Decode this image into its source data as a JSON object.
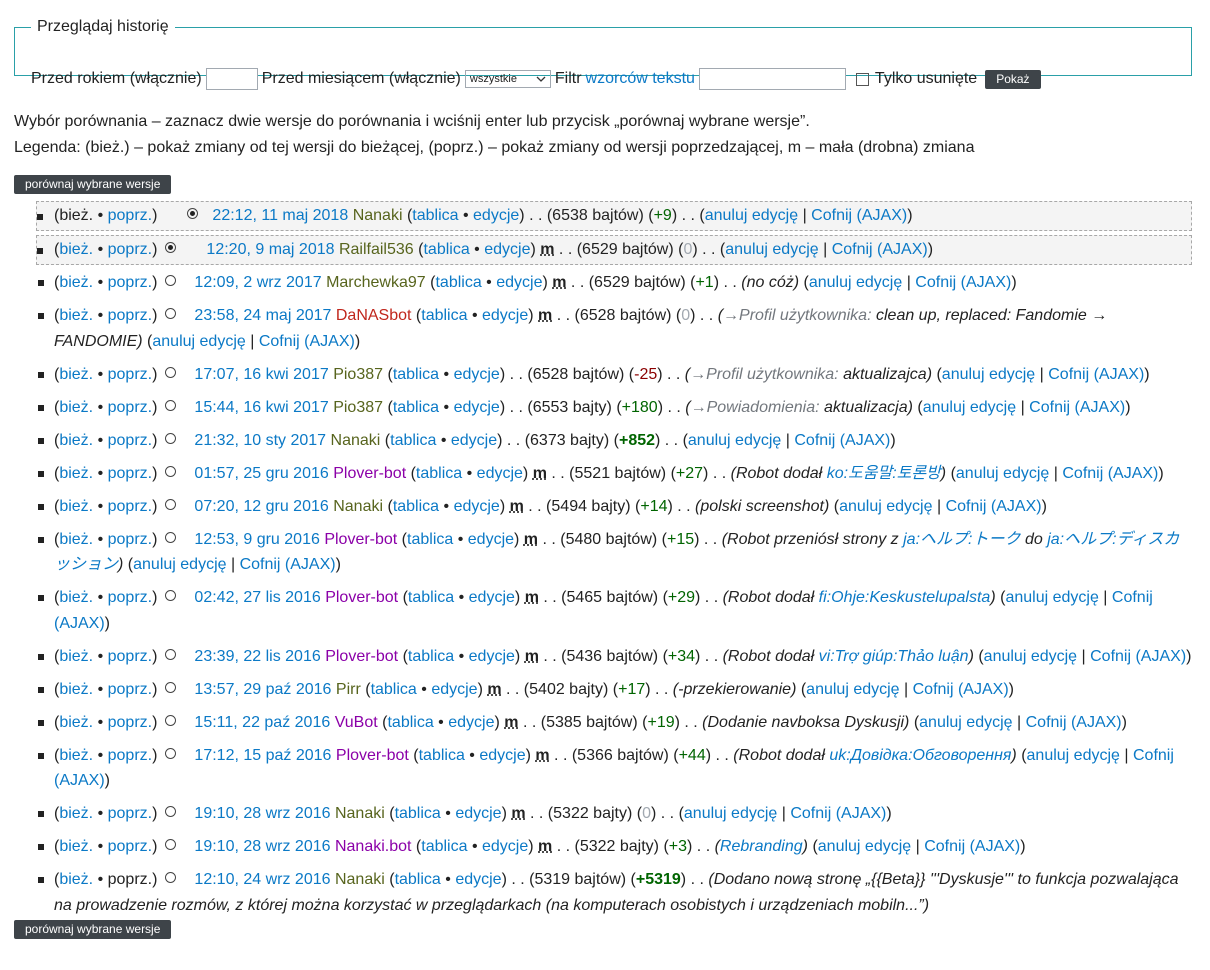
{
  "filter": {
    "legend": "Przeglądaj historię",
    "year_label": "Przed rokiem (włącznie)",
    "month_label": "Przed miesiącem (włącznie)",
    "month_value": "wszystkie",
    "filter_prefix": "Filtr",
    "filter_link": "wzorców tekstu",
    "deleted_label": "Tylko usunięte",
    "show_button": "Pokaż"
  },
  "info": {
    "line1": "Wybór porównania – zaznacz dwie wersje do porównania i wciśnij enter lub przycisk „porównaj wybrane wersje”.",
    "line2": "Legenda: (bież.) – pokaż zmiany od tej wersji do bieżącej, (poprz.) – pokaż zmiany od wersji poprzedzającej, m – mała (drobna) zmiana"
  },
  "compare_button": "porównaj wybrane wersje",
  "labels": {
    "cur": "bież.",
    "prev": "poprz.",
    "talk": "tablica",
    "contribs": "edycje",
    "minor": "m",
    "undo": "anuluj edycję",
    "rollback": "Cofnij (AJAX)"
  },
  "revisions": [
    {
      "date": "22:12, 11 maj 2018",
      "user": "Nanaki",
      "size": "6538 bajtów",
      "diff": "+9",
      "minor": false,
      "summary": ""
    },
    {
      "date": "12:20, 9 maj 2018",
      "user": "Railfail536",
      "size": "6529 bajtów",
      "diff": "0",
      "minor": true,
      "summary": ""
    },
    {
      "date": "12:09, 2 wrz 2017",
      "user": "Marchewka97",
      "size": "6529 bajtów",
      "diff": "+1",
      "minor": true,
      "summary": "no cóż"
    },
    {
      "date": "23:58, 24 maj 2017",
      "user": "DaNASbot",
      "size": "6528 bajtów",
      "diff": "0",
      "minor": true,
      "summary_link": "→Profil użytkownika:",
      "summary": "clean up, replaced: Fandomie → FANDOMIE"
    },
    {
      "date": "17:07, 16 kwi 2017",
      "user": "Pio387",
      "size": "6528 bajtów",
      "diff": "-25",
      "minor": false,
      "summary_link": "→Profil użytkownika:",
      "summary": "aktualizajca"
    },
    {
      "date": "15:44, 16 kwi 2017",
      "user": "Pio387",
      "size": "6553 bajty",
      "diff": "+180",
      "minor": false,
      "summary_link": "→Powiadomienia:",
      "summary": "aktualizacja"
    },
    {
      "date": "21:32, 10 sty 2017",
      "user": "Nanaki",
      "size": "6373 bajty",
      "diff": "+852",
      "minor": false,
      "summary": ""
    },
    {
      "date": "01:57, 25 gru 2016",
      "user": "Plover-bot",
      "size": "5521 bajtów",
      "diff": "+27",
      "minor": true,
      "summary": "Robot dodał",
      "summary_iw": "ko:도움말:토론방"
    },
    {
      "date": "07:20, 12 gru 2016",
      "user": "Nanaki",
      "size": "5494 bajty",
      "diff": "+14",
      "minor": true,
      "summary": "polski screenshot"
    },
    {
      "date": "12:53, 9 gru 2016",
      "user": "Plover-bot",
      "size": "5480 bajtów",
      "diff": "+15",
      "minor": true,
      "summary": "Robot przeniósł strony z",
      "summary_iw": "ja:ヘルプ:トーク",
      "summary_mid": "do",
      "summary_iw2": "ja:ヘルプ:ディスカッション"
    },
    {
      "date": "02:42, 27 lis 2016",
      "user": "Plover-bot",
      "size": "5465 bajtów",
      "diff": "+29",
      "minor": true,
      "summary": "Robot dodał",
      "summary_iw": "fi:Ohje:Keskustelupalsta"
    },
    {
      "date": "23:39, 22 lis 2016",
      "user": "Plover-bot",
      "size": "5436 bajtów",
      "diff": "+34",
      "minor": true,
      "summary": "Robot dodał",
      "summary_iw": "vi:Trợ giúp:Thảo luận"
    },
    {
      "date": "13:57, 29 paź 2016",
      "user": "Pirr",
      "size": "5402 bajty",
      "diff": "+17",
      "minor": true,
      "summary": "-przekierowanie"
    },
    {
      "date": "15:11, 22 paź 2016",
      "user": "VuBot",
      "size": "5385 bajtów",
      "diff": "+19",
      "minor": true,
      "summary": "Dodanie navboksa Dyskusji"
    },
    {
      "date": "17:12, 15 paź 2016",
      "user": "Plover-bot",
      "size": "5366 bajtów",
      "diff": "+44",
      "minor": true,
      "summary": "Robot dodał",
      "summary_iw": "uk:Довідка:Обговорення"
    },
    {
      "date": "19:10, 28 wrz 2016",
      "user": "Nanaki",
      "size": "5322 bajty",
      "diff": "0",
      "minor": true,
      "summary": ""
    },
    {
      "date": "19:10, 28 wrz 2016",
      "user": "Nanaki.bot",
      "size": "5322 bajty",
      "diff": "+3",
      "minor": true,
      "summary_linkonly": "Rebranding"
    },
    {
      "date": "12:10, 24 wrz 2016",
      "user": "Nanaki",
      "size": "5319 bajtów",
      "diff": "+5319",
      "minor": false,
      "summary": "Dodano nową stronę „{{Beta}} '''Dyskusje''' to funkcja pozwalająca na prowadzenie rozmów, z której można korzystać w przeglądarkach (na komputerach osobistych i urządzeniach mobiln...”"
    }
  ]
}
